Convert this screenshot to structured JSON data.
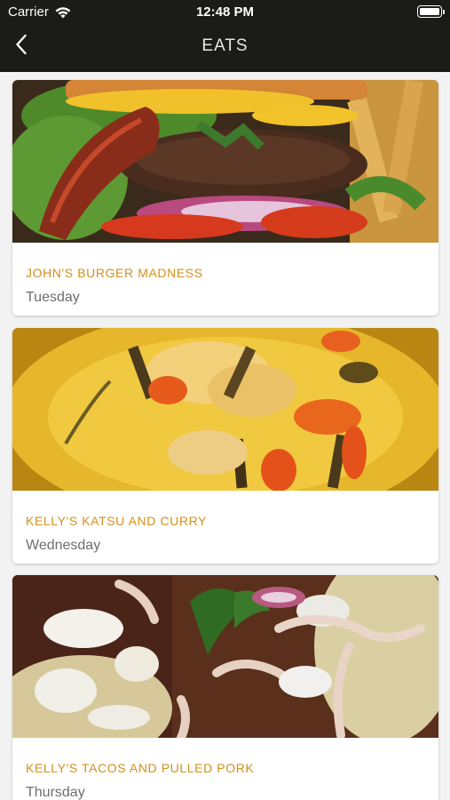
{
  "status_bar": {
    "carrier": "Carrier",
    "time": "12:48 PM"
  },
  "nav": {
    "title": "EATS"
  },
  "cards": [
    {
      "title": "JOHN'S BURGER MADNESS",
      "day": "Tuesday",
      "image": "burger-photo"
    },
    {
      "title": "KELLY'S KATSU AND CURRY",
      "day": "Wednesday",
      "image": "curry-photo"
    },
    {
      "title": "KELLY'S TACOS AND PULLED PORK",
      "day": "Thursday",
      "image": "tacos-photo"
    }
  ],
  "colors": {
    "header_bg": "#1b1b17",
    "accent_title": "#d3901c",
    "subtitle": "#6e6e6e",
    "page_bg": "#f2f2f2"
  }
}
